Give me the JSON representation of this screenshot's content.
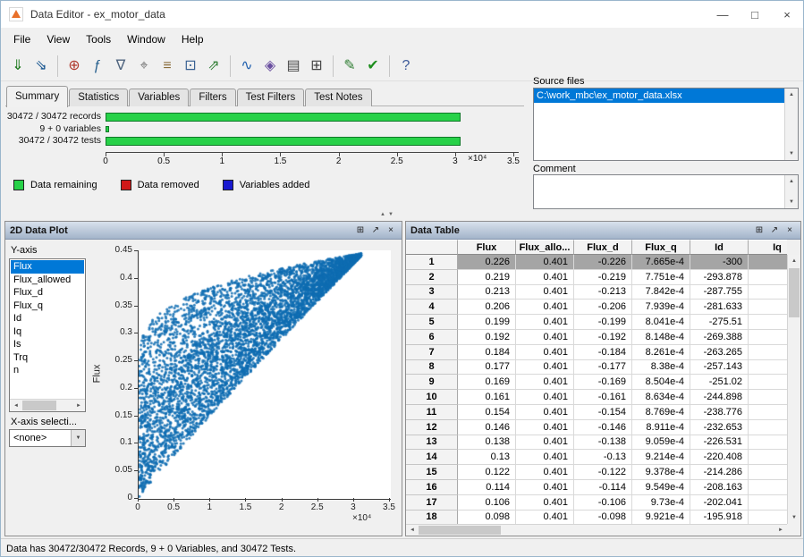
{
  "window": {
    "title": "Data Editor - ex_motor_data",
    "controls": [
      {
        "name": "minimize-button",
        "glyph": "—"
      },
      {
        "name": "maximize-button",
        "glyph": "□"
      },
      {
        "name": "close-button",
        "glyph": "×"
      }
    ]
  },
  "menu": {
    "items": [
      "File",
      "View",
      "Tools",
      "Window",
      "Help"
    ]
  },
  "toolbar": {
    "groups": [
      [
        {
          "name": "open-file-button",
          "glyph": "⇓",
          "color": "#1f7a1f"
        },
        {
          "name": "import-data-button",
          "glyph": "⇘",
          "color": "#16548f"
        }
      ],
      [
        {
          "name": "merge-data-button",
          "glyph": "⊕",
          "color": "#b03a2e"
        },
        {
          "name": "variable-editor-button",
          "glyph": "ƒ",
          "color": "#28618f"
        },
        {
          "name": "filter-editor-button",
          "glyph": "∇",
          "color": "#50657f"
        },
        {
          "name": "test-filter-button",
          "glyph": "⌖",
          "color": "#6f6f6f"
        },
        {
          "name": "notes-editor-button",
          "glyph": "≡",
          "color": "#8a6d3b"
        },
        {
          "name": "print-button",
          "glyph": "⊡",
          "color": "#365f91"
        },
        {
          "name": "export-data-button",
          "glyph": "⇗",
          "color": "#2e7d32"
        }
      ],
      [
        {
          "name": "plot-view-button",
          "glyph": "∿",
          "color": "#1f5fae"
        },
        {
          "name": "surface-view-button",
          "glyph": "◈",
          "color": "#6a4fa0"
        },
        {
          "name": "table-view-button",
          "glyph": "▤",
          "color": "#444444"
        },
        {
          "name": "split-view-button",
          "glyph": "⊞",
          "color": "#444444"
        }
      ],
      [
        {
          "name": "edit-data-button",
          "glyph": "✎",
          "color": "#2e7d32"
        },
        {
          "name": "accept-button",
          "glyph": "✔",
          "color": "#1e8e1e"
        }
      ],
      [
        {
          "name": "help-button",
          "glyph": "?",
          "color": "#3d5a99"
        }
      ]
    ]
  },
  "tabs": [
    {
      "label": "Summary",
      "active": true
    },
    {
      "label": "Statistics",
      "active": false
    },
    {
      "label": "Variables",
      "active": false
    },
    {
      "label": "Filters",
      "active": false
    },
    {
      "label": "Test Filters",
      "active": false
    },
    {
      "label": "Test Notes",
      "active": false
    }
  ],
  "icons": {
    "up": "▲",
    "down": "▼",
    "left": "◄",
    "right": "►",
    "dropdown": "▼"
  },
  "panel_dock_icons": [
    {
      "name": "maximize-panel-icon",
      "glyph": "⊞"
    },
    {
      "name": "undock-panel-icon",
      "glyph": "↗"
    },
    {
      "name": "close-panel-icon",
      "glyph": "×"
    }
  ],
  "chart_data": [
    {
      "type": "bar",
      "orientation": "horizontal",
      "title": "Summary",
      "categories": [
        "30472 / 30472 records",
        "9 + 0 variables",
        "30472 / 30472 tests"
      ],
      "values": [
        30472,
        9,
        30472
      ],
      "bar_color": "#27d148",
      "xlim": [
        0,
        35000
      ],
      "x_ticks": [
        "0",
        "0.5",
        "1",
        "1.5",
        "2",
        "2.5",
        "3",
        "3.5"
      ],
      "x_exponent_label": "×10⁴",
      "legend": [
        {
          "label": "Data remaining",
          "color": "#27d148"
        },
        {
          "label": "Data removed",
          "color": "#d01818"
        },
        {
          "label": "Variables added",
          "color": "#1a1ad0"
        }
      ]
    },
    {
      "type": "scatter",
      "ylabel": "Flux",
      "point_count": 30472,
      "marker_color": "#0e6cb2",
      "xlim": [
        0,
        35000
      ],
      "ylim": [
        0,
        0.45
      ],
      "x_max_data": 31000,
      "x_ticks": [
        "0",
        "0.5",
        "1",
        "1.5",
        "2",
        "2.5",
        "3",
        "3.5"
      ],
      "y_ticks": [
        "0",
        "0.05",
        "0.1",
        "0.15",
        "0.2",
        "0.25",
        "0.3",
        "0.35",
        "0.4",
        "0.45"
      ],
      "x_exponent_label": "×10⁴",
      "envelope": {
        "lower_scale": 0.445,
        "lower_exp": 0.95,
        "upper_base": 0.23,
        "upper_scale": 0.215,
        "upper_exp": 0.3
      }
    }
  ],
  "source_files": {
    "label": "Source files",
    "items": [
      {
        "text": "C:\\work_mbc\\ex_motor_data.xlsx",
        "selected": true
      }
    ]
  },
  "comment": {
    "label": "Comment",
    "value": ""
  },
  "plot_panel": {
    "title": "2D Data Plot",
    "y_axis_label": "Y-axis",
    "x_axis_label": "X-axis selecti...",
    "x_selection": "<none>",
    "y_variables": [
      "Flux",
      "Flux_allowed",
      "Flux_d",
      "Flux_q",
      "Id",
      "Iq",
      "Is",
      "Trq",
      "n"
    ],
    "selected_variable": "Flux"
  },
  "data_table": {
    "title": "Data Table",
    "columns": [
      "Flux",
      "Flux_allo...",
      "Flux_d",
      "Flux_q",
      "Id",
      "Iq"
    ],
    "selected_row": "1",
    "rows": [
      [
        "1",
        "0.226",
        "0.401",
        "-0.226",
        "7.665e-4",
        "-300",
        ""
      ],
      [
        "2",
        "0.219",
        "0.401",
        "-0.219",
        "7.751e-4",
        "-293.878",
        ""
      ],
      [
        "3",
        "0.213",
        "0.401",
        "-0.213",
        "7.842e-4",
        "-287.755",
        ""
      ],
      [
        "4",
        "0.206",
        "0.401",
        "-0.206",
        "7.939e-4",
        "-281.633",
        ""
      ],
      [
        "5",
        "0.199",
        "0.401",
        "-0.199",
        "8.041e-4",
        "-275.51",
        ""
      ],
      [
        "6",
        "0.192",
        "0.401",
        "-0.192",
        "8.148e-4",
        "-269.388",
        ""
      ],
      [
        "7",
        "0.184",
        "0.401",
        "-0.184",
        "8.261e-4",
        "-263.265",
        ""
      ],
      [
        "8",
        "0.177",
        "0.401",
        "-0.177",
        "8.38e-4",
        "-257.143",
        ""
      ],
      [
        "9",
        "0.169",
        "0.401",
        "-0.169",
        "8.504e-4",
        "-251.02",
        ""
      ],
      [
        "10",
        "0.161",
        "0.401",
        "-0.161",
        "8.634e-4",
        "-244.898",
        ""
      ],
      [
        "11",
        "0.154",
        "0.401",
        "-0.154",
        "8.769e-4",
        "-238.776",
        ""
      ],
      [
        "12",
        "0.146",
        "0.401",
        "-0.146",
        "8.911e-4",
        "-232.653",
        ""
      ],
      [
        "13",
        "0.138",
        "0.401",
        "-0.138",
        "9.059e-4",
        "-226.531",
        ""
      ],
      [
        "14",
        "0.13",
        "0.401",
        "-0.13",
        "9.214e-4",
        "-220.408",
        ""
      ],
      [
        "15",
        "0.122",
        "0.401",
        "-0.122",
        "9.378e-4",
        "-214.286",
        ""
      ],
      [
        "16",
        "0.114",
        "0.401",
        "-0.114",
        "9.549e-4",
        "-208.163",
        ""
      ],
      [
        "17",
        "0.106",
        "0.401",
        "-0.106",
        "9.73e-4",
        "-202.041",
        ""
      ],
      [
        "18",
        "0.098",
        "0.401",
        "-0.098",
        "9.921e-4",
        "-195.918",
        ""
      ]
    ]
  },
  "status_bar": {
    "text": "Data has 30472/30472 Records, 9 + 0 Variables, and 30472 Tests."
  }
}
